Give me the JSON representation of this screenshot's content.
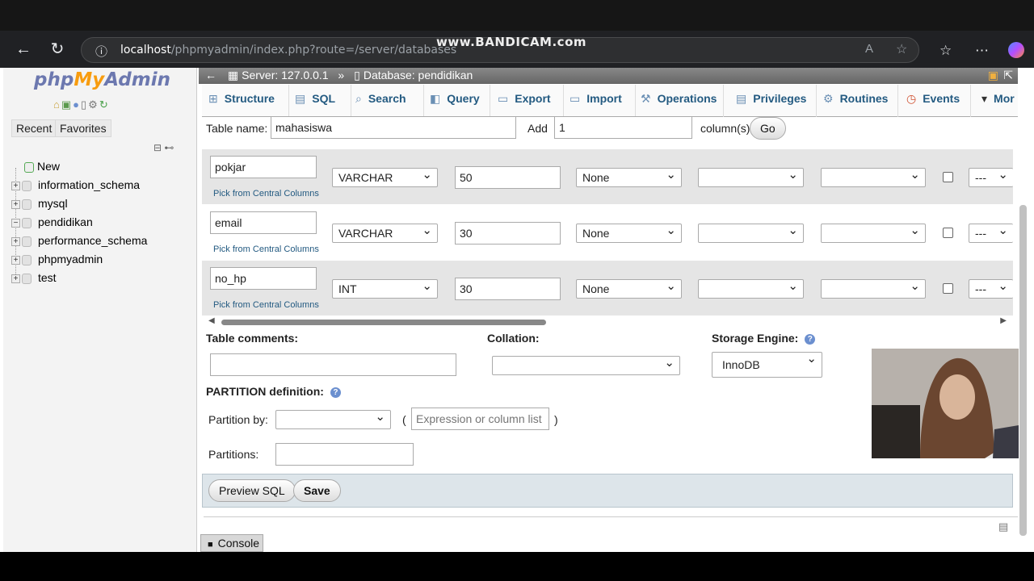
{
  "browser": {
    "url_host": "localhost",
    "url_path": "/phpmyadmin/index.php?route=/server/databases",
    "watermark": "www.BANDICAM.com"
  },
  "sidebar": {
    "logo_php": "php",
    "logo_my": "My",
    "logo_admin": "Admin",
    "tab_recent": "Recent",
    "tab_favorites": "Favorites",
    "tree": [
      {
        "label": "New",
        "expander": ""
      },
      {
        "label": "information_schema",
        "expander": "+"
      },
      {
        "label": "mysql",
        "expander": "+"
      },
      {
        "label": "pendidikan",
        "expander": "−"
      },
      {
        "label": "performance_schema",
        "expander": "+"
      },
      {
        "label": "phpmyadmin",
        "expander": "+"
      },
      {
        "label": "test",
        "expander": "+"
      }
    ]
  },
  "breadcrumb": {
    "server": "Server: 127.0.0.1",
    "separator": "»",
    "database": "Database: pendidikan"
  },
  "tabs": [
    "Structure",
    "SQL",
    "Search",
    "Query",
    "Export",
    "Import",
    "Operations",
    "Privileges",
    "Routines",
    "Events",
    "Mor"
  ],
  "form": {
    "table_name_label": "Table name:",
    "table_name_value": "mahasiswa",
    "add_label": "Add",
    "add_value": "1",
    "columns_label": "column(s)",
    "go_label": "Go",
    "pick_label": "Pick from Central Columns",
    "columns": [
      {
        "name": "pokjar",
        "type": "VARCHAR",
        "length": "50",
        "default": "None",
        "extra": "---"
      },
      {
        "name": "email",
        "type": "VARCHAR",
        "length": "30",
        "default": "None",
        "extra": "---"
      },
      {
        "name": "no_hp",
        "type": "INT",
        "length": "30",
        "default": "None",
        "extra": "---"
      }
    ],
    "table_comments_label": "Table comments:",
    "collation_label": "Collation:",
    "storage_engine_label": "Storage Engine:",
    "storage_engine_value": "InnoDB",
    "partition_label": "PARTITION definition:",
    "partition_by_label": "Partition by:",
    "open_paren": "(",
    "close_paren": ")",
    "expression_placeholder": "Expression or column list",
    "partitions_label": "Partitions:",
    "preview_sql_label": "Preview SQL",
    "save_label": "Save"
  },
  "console_label": "Console"
}
